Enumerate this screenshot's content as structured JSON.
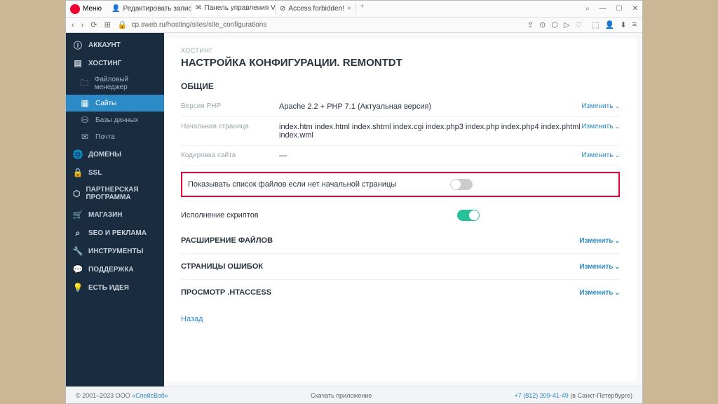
{
  "browser": {
    "menu_label": "Меню",
    "tabs": [
      {
        "label": "Редактировать запись \"Th",
        "icon": "user"
      },
      {
        "label": "Панель управления VH",
        "icon": "mail",
        "active": true
      },
      {
        "label": "Access forbidden!",
        "icon": "blocked"
      }
    ],
    "url": "cp.sweb.ru/hosting/sites/site_configurations"
  },
  "sidebar": {
    "items": [
      {
        "label": "АККАУНТ",
        "icon": "user-circle"
      },
      {
        "label": "ХОСТИНГ",
        "icon": "server"
      },
      {
        "label": "Файловый менеджер",
        "icon": "folder",
        "sub": true
      },
      {
        "label": "Сайты",
        "icon": "sites",
        "sub": true,
        "active": true
      },
      {
        "label": "Базы данных",
        "icon": "db",
        "sub": true
      },
      {
        "label": "Почта",
        "icon": "mail",
        "sub": true
      },
      {
        "label": "ДОМЕНЫ",
        "icon": "globe"
      },
      {
        "label": "SSL",
        "icon": "lock"
      },
      {
        "label": "ПАРТНЕРСКАЯ ПРОГРАММА",
        "icon": "badge"
      },
      {
        "label": "МАГАЗИН",
        "icon": "cart"
      },
      {
        "label": "SEO И РЕКЛАМА",
        "icon": "search"
      },
      {
        "label": "ИНСТРУМЕНТЫ",
        "icon": "wrench"
      },
      {
        "label": "ПОДДЕРЖКА",
        "icon": "chat"
      },
      {
        "label": "ЕСТЬ ИДЕЯ",
        "icon": "bulb"
      }
    ]
  },
  "main": {
    "breadcrumb": "ХОСТИНГ",
    "title": "НАСТРОЙКА КОНФИГУРАЦИИ. REMONTDT",
    "section_general": "ОБЩИЕ",
    "rows": {
      "php_label": "Версия PHP",
      "php_value": "Apache 2.2 + PHP 7.1 (Актуальная версия)",
      "start_label": "Начальная страница",
      "start_value": "index.htm index.html index.shtml index.cgi index.php3 index.php index.php4 index.phtml index.wml",
      "enc_label": "Кодировка сайта",
      "enc_value": "—"
    },
    "change_label": "Изменить",
    "toggle1_label": "Показывать список файлов если нет начальной страницы",
    "toggle1_on": false,
    "toggle2_label": "Исполнение скриптов",
    "toggle2_on": true,
    "expand1": "РАСШИРЕНИЕ ФАЙЛОВ",
    "expand2": "СТРАНИЦЫ ОШИБОК",
    "expand3": "ПРОСМОТР .HTACCESS",
    "back": "Назад"
  },
  "footer": {
    "copyright_prefix": "© 2001–2023 ООО ",
    "copyright_link": "«СпейсВэб»",
    "center": "Скачать приложение",
    "phone": "+7 (812) 209-41-49",
    "phone_suffix": " (в Санкт-Петербурге)"
  }
}
